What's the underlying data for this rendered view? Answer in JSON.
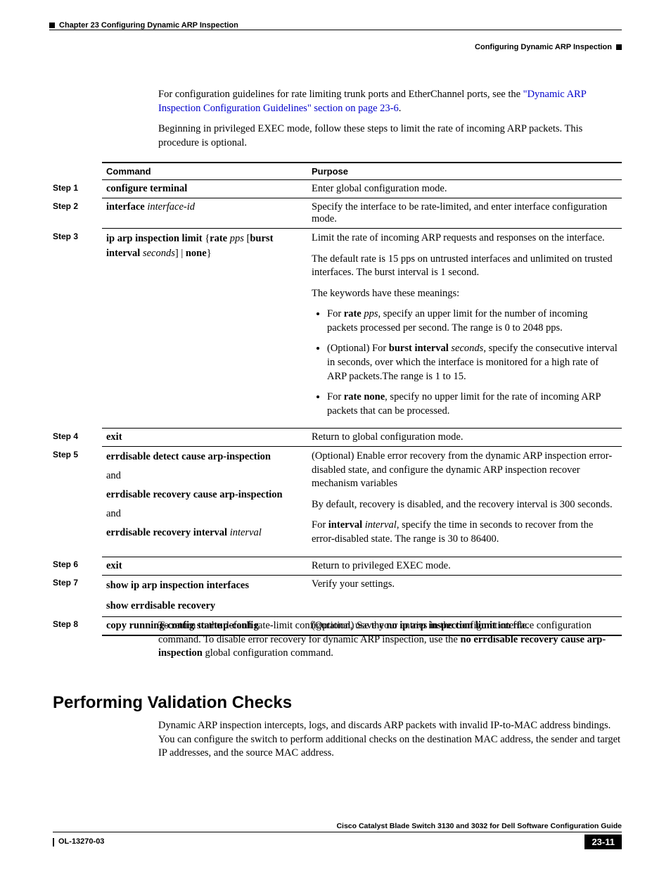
{
  "header": {
    "chapter_line": "Chapter 23      Configuring Dynamic ARP Inspection",
    "section": "Configuring Dynamic ARP Inspection"
  },
  "intro": {
    "p1_a": "For configuration guidelines for rate limiting trunk ports and EtherChannel ports, see the ",
    "p1_link": "\"Dynamic ARP Inspection Configuration Guidelines\" section on page 23-6",
    "p1_b": ".",
    "p2": "Beginning in privileged EXEC mode, follow these steps to limit the rate of incoming ARP packets. This procedure is optional."
  },
  "table": {
    "headers": {
      "command": "Command",
      "purpose": "Purpose"
    },
    "steps": [
      {
        "step": "Step 1",
        "cmd_bold1": "configure terminal",
        "purpose_plain": "Enter global configuration mode."
      },
      {
        "step": "Step 2",
        "cmd_bold1": "interface",
        "cmd_ital1": " interface-id",
        "purpose_plain": "Specify the interface to be rate-limited, and enter interface configuration mode."
      },
      {
        "step": "Step 3",
        "cmd_s3_a": "ip arp inspection limit",
        "cmd_s3_b": " {",
        "cmd_s3_c": "rate",
        "cmd_s3_d": " pps",
        "cmd_s3_e": " [",
        "cmd_s3_f": "burst interval",
        "cmd_s3_g": " seconds",
        "cmd_s3_h": "] | ",
        "cmd_s3_i": "none",
        "cmd_s3_j": "}",
        "p1": "Limit the rate of incoming ARP requests and responses on the interface.",
        "p2": "The default rate is 15 pps on untrusted interfaces and unlimited on trusted interfaces. The burst interval is 1 second.",
        "p3": "The keywords have these meanings:",
        "li1_a": "For ",
        "li1_b": "rate",
        "li1_c": " pps",
        "li1_d": ", specify an upper limit for the number of incoming packets processed per second. The range is 0 to 2048 pps.",
        "li2_a": "(Optional) For ",
        "li2_b": "burst interval",
        "li2_c": " seconds",
        "li2_d": ", specify the consecutive interval in seconds, over which the interface is monitored for a high rate of ARP packets.The range is 1 to 15.",
        "li3_a": "For ",
        "li3_b": "rate none",
        "li3_c": ", specify no upper limit for the rate of incoming ARP packets that can be processed."
      },
      {
        "step": "Step 4",
        "cmd_bold1": "exit",
        "purpose_plain": "Return to global configuration mode."
      },
      {
        "step": "Step 5",
        "cmd_s5_1": "errdisable detect cause arp-inspection",
        "cmd_s5_and1": "and",
        "cmd_s5_2": "errdisable recovery cause arp-inspection",
        "cmd_s5_and2": "and",
        "cmd_s5_3a": "errdisable recovery interval",
        "cmd_s5_3b": " interval",
        "p1": "(Optional) Enable error recovery from the dynamic ARP inspection error-disabled state, and configure the dynamic ARP inspection recover mechanism variables",
        "p2": "By default, recovery is disabled, and the recovery interval is 300 seconds.",
        "p3_a": "For ",
        "p3_b": "interval",
        "p3_c": " interval",
        "p3_d": ", specify the time in seconds to recover from the error-disabled state. The range is 30 to 86400."
      },
      {
        "step": "Step 6",
        "cmd_bold1": "exit",
        "purpose_plain": "Return to privileged EXEC mode."
      },
      {
        "step": "Step 7",
        "cmd_s7_1": "show ip arp inspection interfaces",
        "cmd_s7_2": "show errdisable recovery",
        "purpose_plain": "Verify your settings."
      },
      {
        "step": "Step 8",
        "cmd_bold1": "copy running-config startup-config",
        "purpose_plain": "(Optional) Save your entries in the configuration file."
      }
    ]
  },
  "after_table": {
    "a": "To return to the default rate-limit configuration, use the ",
    "b": "no ip arp inspection limit",
    "c": " interface configuration command. To disable error recovery for dynamic ARP inspection, use the ",
    "d": "no errdisable recovery cause arp-inspection",
    "e": " global configuration command."
  },
  "h2": "Performing Validation Checks",
  "after_h2": "Dynamic ARP inspection intercepts, logs, and discards ARP packets with invalid IP-to-MAC address bindings. You can configure the switch to perform additional checks on the destination MAC address, the sender and target IP addresses, and the source MAC address.",
  "footer": {
    "book": "Cisco Catalyst Blade Switch 3130 and 3032 for Dell Software Configuration Guide",
    "doc_id": "OL-13270-03",
    "page": "23-11"
  }
}
